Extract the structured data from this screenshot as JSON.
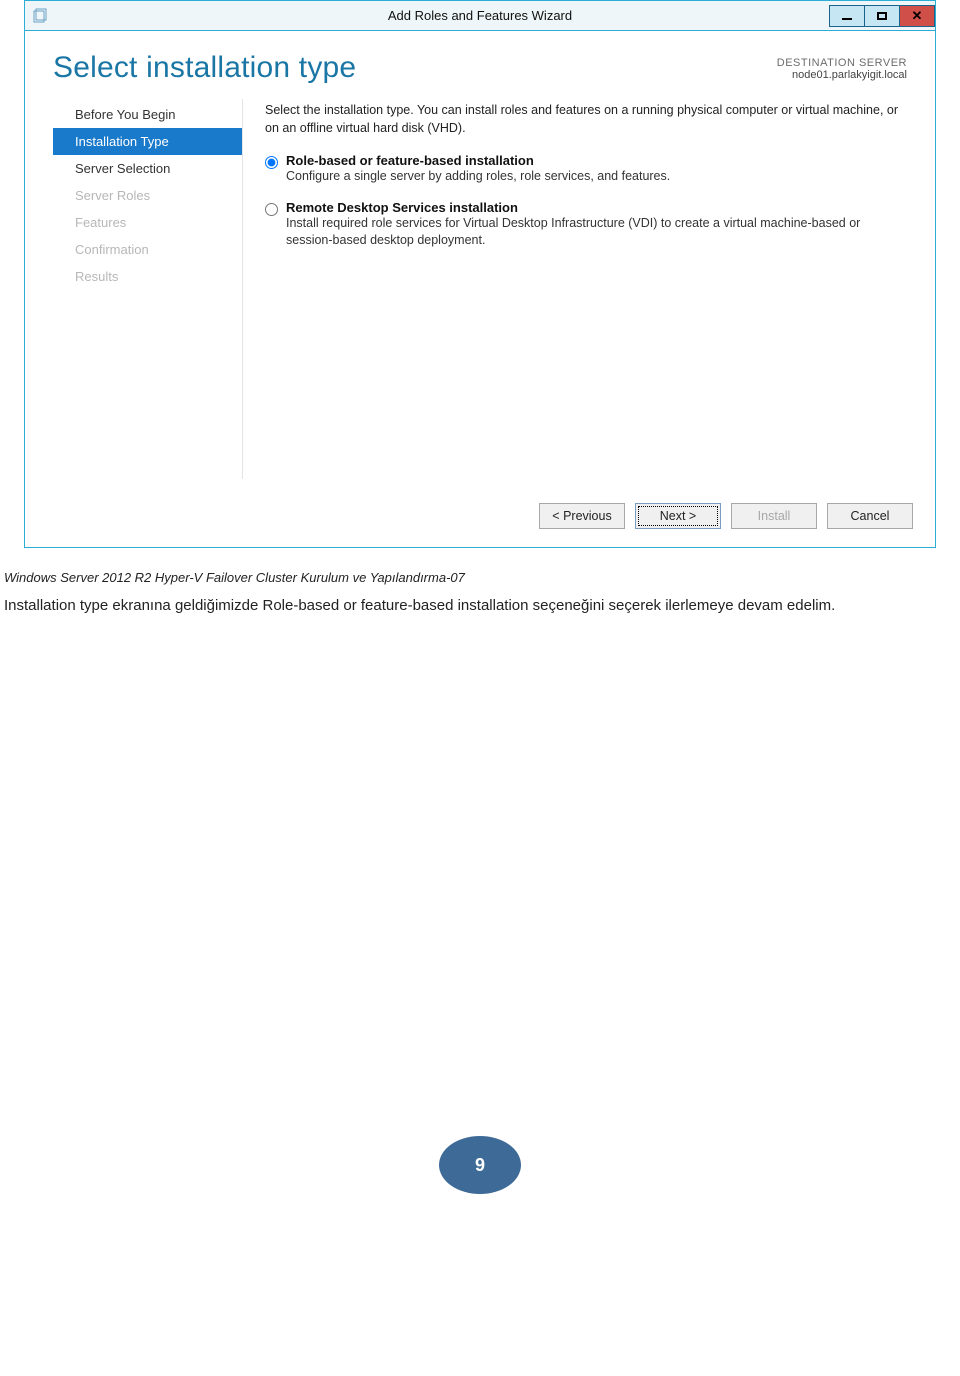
{
  "window": {
    "title": "Add Roles and Features Wizard",
    "page_title": "Select installation type",
    "destination": {
      "label": "DESTINATION SERVER",
      "value": "node01.parlakyigit.local"
    },
    "sidebar": {
      "items": [
        {
          "label": "Before You Begin",
          "state": "normal"
        },
        {
          "label": "Installation Type",
          "state": "active"
        },
        {
          "label": "Server Selection",
          "state": "normal"
        },
        {
          "label": "Server Roles",
          "state": "disabled"
        },
        {
          "label": "Features",
          "state": "disabled"
        },
        {
          "label": "Confirmation",
          "state": "disabled"
        },
        {
          "label": "Results",
          "state": "disabled"
        }
      ]
    },
    "intro": "Select the installation type. You can install roles and features on a running physical computer or virtual machine, or on an offline virtual hard disk (VHD).",
    "options": [
      {
        "title": "Role-based or feature-based installation",
        "desc": "Configure a single server by adding roles, role services, and features.",
        "checked": true
      },
      {
        "title": "Remote Desktop Services installation",
        "desc": "Install required role services for Virtual Desktop Infrastructure (VDI) to create a virtual machine-based or session-based desktop deployment.",
        "checked": false
      }
    ],
    "buttons": {
      "previous": "< Previous",
      "next": "Next >",
      "install": "Install",
      "cancel": "Cancel"
    }
  },
  "caption": "Windows Server 2012 R2 Hyper-V Failover Cluster Kurulum ve Yapılandırma-07",
  "paragraph": "Installation type ekranına geldiğimizde Role-based or feature-based installation seçeneğini seçerek ilerlemeye devam edelim.",
  "page_number": "9"
}
